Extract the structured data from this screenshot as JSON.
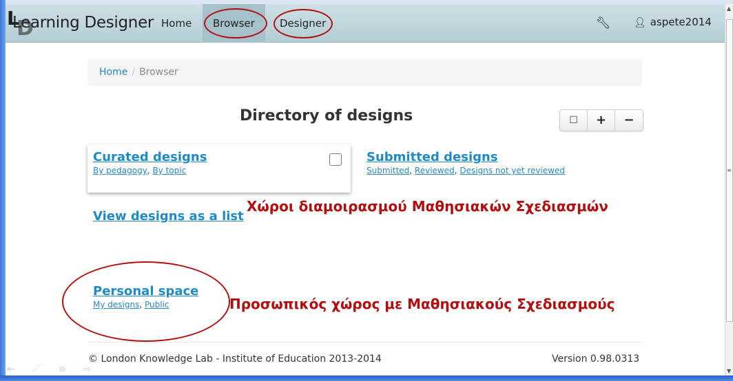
{
  "navbar": {
    "logo_letters": [
      "L",
      "D"
    ],
    "brand": "Learning Designer",
    "items": [
      {
        "label": "Home",
        "active": false
      },
      {
        "label": "Browser",
        "active": true
      },
      {
        "label": "Designer",
        "active": false
      }
    ],
    "settings_icon": "wrench-icon",
    "user_icon": "user-icon",
    "username": "aspete2014"
  },
  "breadcrumb": {
    "items": [
      {
        "label": "Home",
        "link": true
      },
      {
        "label": "Browser",
        "link": false
      }
    ],
    "separator": "/"
  },
  "main": {
    "title": "Directory of designs",
    "toolbar": {
      "bookmark_icon": "bookmark-icon",
      "expand_label": "+",
      "collapse_label": "−"
    },
    "curated": {
      "title": "Curated designs",
      "links": [
        "By pedagogy",
        "By topic"
      ],
      "checkbox_checked": false
    },
    "submitted": {
      "title": "Submitted designs",
      "links": [
        "Submitted",
        "Reviewed",
        "Designs not yet reviewed"
      ]
    },
    "view_list": "View designs as a list",
    "personal": {
      "title": "Personal space",
      "links": [
        "My designs",
        "Public"
      ]
    }
  },
  "annotations": {
    "shared_spaces": "Χώροι διαμοιρασμού Μαθησιακών Σχεδιασμών",
    "personal_space": "Προσωπικός χώρος με Μαθησιακούς Σχεδιασμούς",
    "color": "#b01010"
  },
  "footer": {
    "copyright": "© London Knowledge Lab - Institute of Education 2013-2014",
    "version": "Version 0.98.0313"
  },
  "colors": {
    "link": "#1f8ac4",
    "navbar": "#b3cdd4",
    "nav_active": "#a5c1c9"
  }
}
